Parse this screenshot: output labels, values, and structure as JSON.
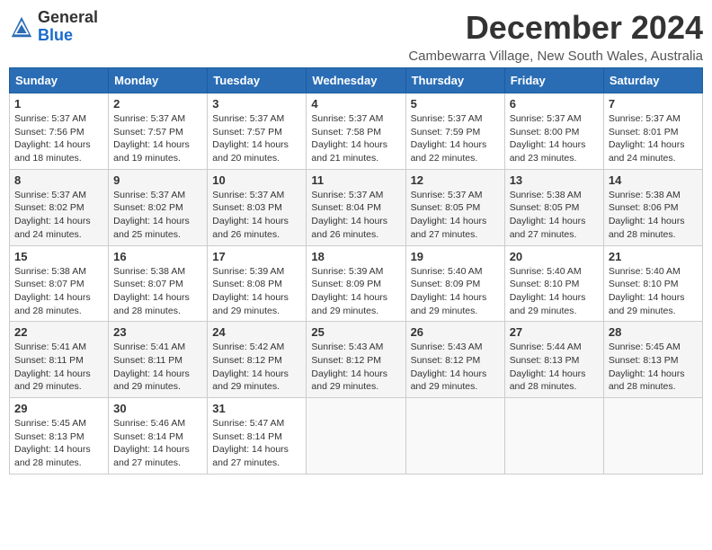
{
  "header": {
    "logo_line1": "General",
    "logo_line2": "Blue",
    "month_title": "December 2024",
    "subtitle": "Cambewarra Village, New South Wales, Australia"
  },
  "columns": [
    "Sunday",
    "Monday",
    "Tuesday",
    "Wednesday",
    "Thursday",
    "Friday",
    "Saturday"
  ],
  "weeks": [
    [
      {
        "day": "1",
        "lines": [
          "Sunrise: 5:37 AM",
          "Sunset: 7:56 PM",
          "Daylight: 14 hours",
          "and 18 minutes."
        ]
      },
      {
        "day": "2",
        "lines": [
          "Sunrise: 5:37 AM",
          "Sunset: 7:57 PM",
          "Daylight: 14 hours",
          "and 19 minutes."
        ]
      },
      {
        "day": "3",
        "lines": [
          "Sunrise: 5:37 AM",
          "Sunset: 7:57 PM",
          "Daylight: 14 hours",
          "and 20 minutes."
        ]
      },
      {
        "day": "4",
        "lines": [
          "Sunrise: 5:37 AM",
          "Sunset: 7:58 PM",
          "Daylight: 14 hours",
          "and 21 minutes."
        ]
      },
      {
        "day": "5",
        "lines": [
          "Sunrise: 5:37 AM",
          "Sunset: 7:59 PM",
          "Daylight: 14 hours",
          "and 22 minutes."
        ]
      },
      {
        "day": "6",
        "lines": [
          "Sunrise: 5:37 AM",
          "Sunset: 8:00 PM",
          "Daylight: 14 hours",
          "and 23 minutes."
        ]
      },
      {
        "day": "7",
        "lines": [
          "Sunrise: 5:37 AM",
          "Sunset: 8:01 PM",
          "Daylight: 14 hours",
          "and 24 minutes."
        ]
      }
    ],
    [
      {
        "day": "8",
        "lines": [
          "Sunrise: 5:37 AM",
          "Sunset: 8:02 PM",
          "Daylight: 14 hours",
          "and 24 minutes."
        ]
      },
      {
        "day": "9",
        "lines": [
          "Sunrise: 5:37 AM",
          "Sunset: 8:02 PM",
          "Daylight: 14 hours",
          "and 25 minutes."
        ]
      },
      {
        "day": "10",
        "lines": [
          "Sunrise: 5:37 AM",
          "Sunset: 8:03 PM",
          "Daylight: 14 hours",
          "and 26 minutes."
        ]
      },
      {
        "day": "11",
        "lines": [
          "Sunrise: 5:37 AM",
          "Sunset: 8:04 PM",
          "Daylight: 14 hours",
          "and 26 minutes."
        ]
      },
      {
        "day": "12",
        "lines": [
          "Sunrise: 5:37 AM",
          "Sunset: 8:05 PM",
          "Daylight: 14 hours",
          "and 27 minutes."
        ]
      },
      {
        "day": "13",
        "lines": [
          "Sunrise: 5:38 AM",
          "Sunset: 8:05 PM",
          "Daylight: 14 hours",
          "and 27 minutes."
        ]
      },
      {
        "day": "14",
        "lines": [
          "Sunrise: 5:38 AM",
          "Sunset: 8:06 PM",
          "Daylight: 14 hours",
          "and 28 minutes."
        ]
      }
    ],
    [
      {
        "day": "15",
        "lines": [
          "Sunrise: 5:38 AM",
          "Sunset: 8:07 PM",
          "Daylight: 14 hours",
          "and 28 minutes."
        ]
      },
      {
        "day": "16",
        "lines": [
          "Sunrise: 5:38 AM",
          "Sunset: 8:07 PM",
          "Daylight: 14 hours",
          "and 28 minutes."
        ]
      },
      {
        "day": "17",
        "lines": [
          "Sunrise: 5:39 AM",
          "Sunset: 8:08 PM",
          "Daylight: 14 hours",
          "and 29 minutes."
        ]
      },
      {
        "day": "18",
        "lines": [
          "Sunrise: 5:39 AM",
          "Sunset: 8:09 PM",
          "Daylight: 14 hours",
          "and 29 minutes."
        ]
      },
      {
        "day": "19",
        "lines": [
          "Sunrise: 5:40 AM",
          "Sunset: 8:09 PM",
          "Daylight: 14 hours",
          "and 29 minutes."
        ]
      },
      {
        "day": "20",
        "lines": [
          "Sunrise: 5:40 AM",
          "Sunset: 8:10 PM",
          "Daylight: 14 hours",
          "and 29 minutes."
        ]
      },
      {
        "day": "21",
        "lines": [
          "Sunrise: 5:40 AM",
          "Sunset: 8:10 PM",
          "Daylight: 14 hours",
          "and 29 minutes."
        ]
      }
    ],
    [
      {
        "day": "22",
        "lines": [
          "Sunrise: 5:41 AM",
          "Sunset: 8:11 PM",
          "Daylight: 14 hours",
          "and 29 minutes."
        ]
      },
      {
        "day": "23",
        "lines": [
          "Sunrise: 5:41 AM",
          "Sunset: 8:11 PM",
          "Daylight: 14 hours",
          "and 29 minutes."
        ]
      },
      {
        "day": "24",
        "lines": [
          "Sunrise: 5:42 AM",
          "Sunset: 8:12 PM",
          "Daylight: 14 hours",
          "and 29 minutes."
        ]
      },
      {
        "day": "25",
        "lines": [
          "Sunrise: 5:43 AM",
          "Sunset: 8:12 PM",
          "Daylight: 14 hours",
          "and 29 minutes."
        ]
      },
      {
        "day": "26",
        "lines": [
          "Sunrise: 5:43 AM",
          "Sunset: 8:12 PM",
          "Daylight: 14 hours",
          "and 29 minutes."
        ]
      },
      {
        "day": "27",
        "lines": [
          "Sunrise: 5:44 AM",
          "Sunset: 8:13 PM",
          "Daylight: 14 hours",
          "and 28 minutes."
        ]
      },
      {
        "day": "28",
        "lines": [
          "Sunrise: 5:45 AM",
          "Sunset: 8:13 PM",
          "Daylight: 14 hours",
          "and 28 minutes."
        ]
      }
    ],
    [
      {
        "day": "29",
        "lines": [
          "Sunrise: 5:45 AM",
          "Sunset: 8:13 PM",
          "Daylight: 14 hours",
          "and 28 minutes."
        ]
      },
      {
        "day": "30",
        "lines": [
          "Sunrise: 5:46 AM",
          "Sunset: 8:14 PM",
          "Daylight: 14 hours",
          "and 27 minutes."
        ]
      },
      {
        "day": "31",
        "lines": [
          "Sunrise: 5:47 AM",
          "Sunset: 8:14 PM",
          "Daylight: 14 hours",
          "and 27 minutes."
        ]
      },
      null,
      null,
      null,
      null
    ]
  ]
}
